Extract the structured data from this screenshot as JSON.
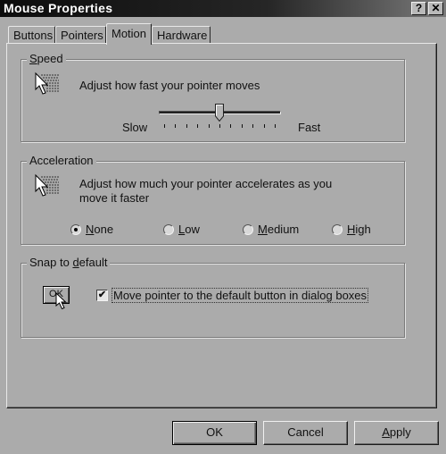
{
  "window": {
    "title": "Mouse Properties",
    "help_button": "?",
    "close_button": "✕"
  },
  "tabs": [
    {
      "label": "Buttons",
      "active": false
    },
    {
      "label": "Pointers",
      "active": false
    },
    {
      "label": "Motion",
      "active": true
    },
    {
      "label": "Hardware",
      "active": false
    }
  ],
  "speed": {
    "title_accel": "S",
    "title_rest": "peed",
    "description": "Adjust how fast your pointer moves",
    "slow_label": "Slow",
    "fast_label": "Fast",
    "slider_value_fraction": 0.5,
    "tick_count": 11
  },
  "acceleration": {
    "title": "Acceleration",
    "description_line1": "Adjust how much your pointer accelerates as you",
    "description_line2": "move it faster",
    "options": [
      {
        "accel": "N",
        "rest": "one",
        "checked": true
      },
      {
        "accel": "L",
        "rest": "ow",
        "checked": false
      },
      {
        "accel": "M",
        "rest": "edium",
        "checked": false
      },
      {
        "accel": "H",
        "rest": "igh",
        "checked": false
      }
    ]
  },
  "snap": {
    "title_pre": "Snap to ",
    "title_accel": "d",
    "title_rest": "efault",
    "demo_button_label": "OK",
    "checkbox_checked": true,
    "checkbox_mark": "✔",
    "checkbox_label": "Move pointer to the default button in dialog boxes"
  },
  "buttons": {
    "ok": "OK",
    "cancel": "Cancel",
    "apply_accel": "A",
    "apply_rest": "pply"
  }
}
